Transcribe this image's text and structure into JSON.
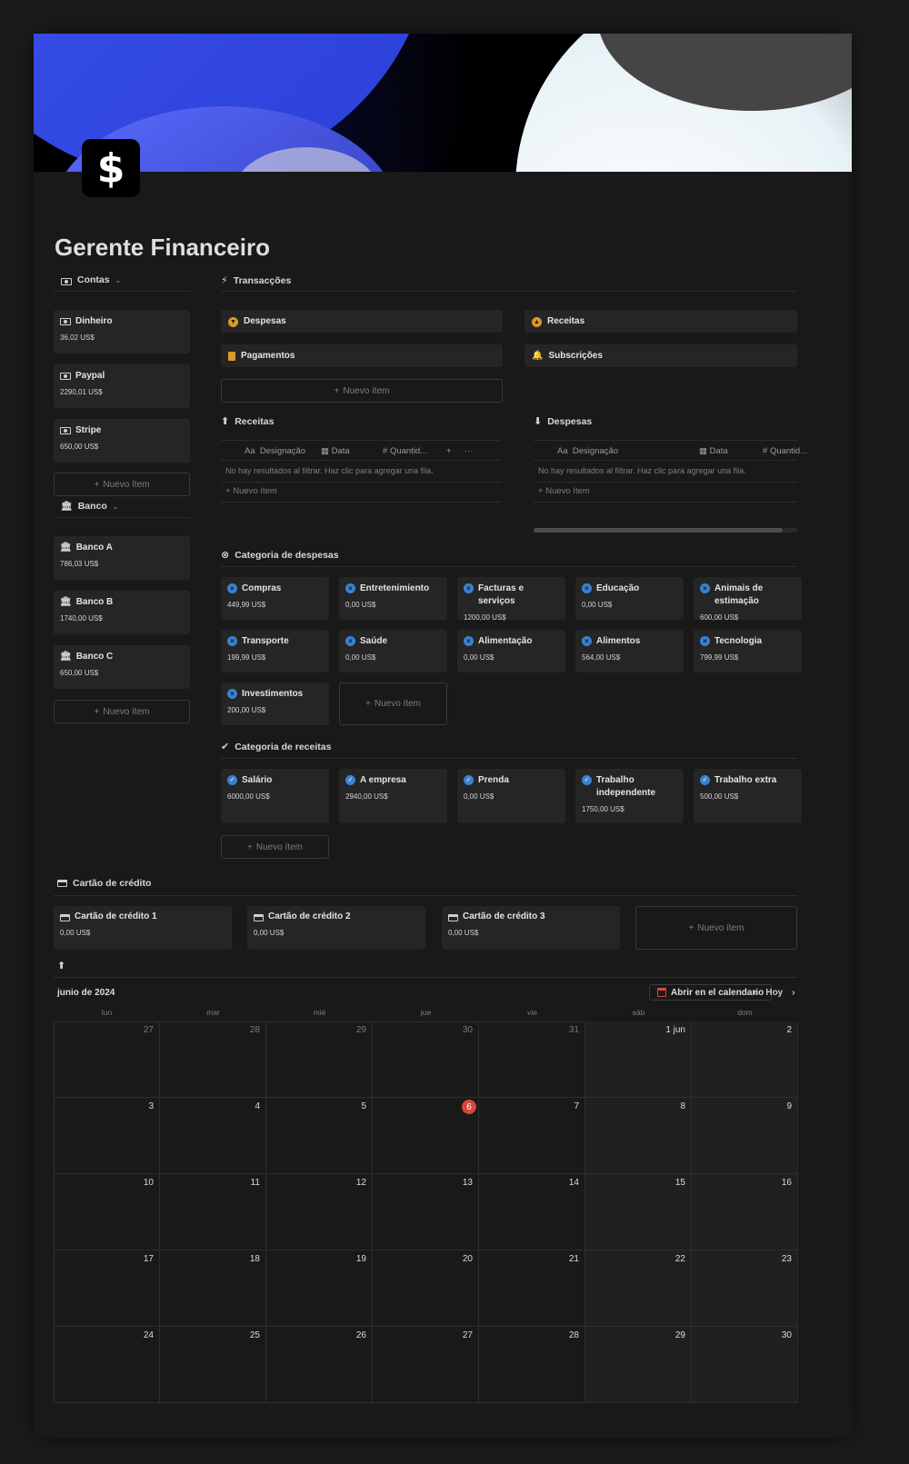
{
  "page": {
    "title": "Gerente Financeiro",
    "icon": "dollar-icon",
    "icon_glyph": "$"
  },
  "colors": {
    "background": "#191919",
    "card": "#252525",
    "accent_blue": "#3a82d0",
    "accent_orange": "#d99a2b",
    "today_red": "#d9453c"
  },
  "contas": {
    "heading": "Contas",
    "items": [
      {
        "name": "Dinheiro",
        "value": "36,02 US$"
      },
      {
        "name": "Paypal",
        "value": "2290,01 US$"
      },
      {
        "name": "Stripe",
        "value": "650,00 US$"
      }
    ],
    "new_label": "Nuevo ítem"
  },
  "banco": {
    "heading": "Banco",
    "items": [
      {
        "name": "Banco A",
        "value": "786,03 US$"
      },
      {
        "name": "Banco B",
        "value": "1740,00 US$"
      },
      {
        "name": "Banco C",
        "value": "650,00 US$"
      }
    ],
    "new_label": "Nuevo ítem"
  },
  "transaccoes": {
    "heading": "Transacções",
    "items": [
      "Despesas",
      "Receitas",
      "Pagamentos",
      "Subscrições"
    ],
    "new_label": "Nuevo ítem"
  },
  "receitas_table": {
    "heading": "Receitas",
    "cols": [
      "Designação",
      "Data",
      "Quantid..."
    ],
    "col_prefix": "Aa",
    "add_col": "+",
    "more": "···",
    "empty": "No hay resultados al filtrar. Haz clic para agregar una fila.",
    "new_label": "Nuevo ítem"
  },
  "despesas_table": {
    "heading": "Despesas",
    "cols": [
      "Designação",
      "Data",
      "Quantid..."
    ],
    "col_prefix": "Aa",
    "empty": "No hay resultados al filtrar. Haz clic para agregar una fila.",
    "new_label": "Nuevo ítem"
  },
  "categoria_despesas": {
    "heading": "Categoria de despesas",
    "items": [
      {
        "name": "Compras",
        "value": "449,99 US$"
      },
      {
        "name": "Entretenimiento",
        "value": "0,00 US$"
      },
      {
        "name": "Facturas e serviços",
        "value": "1200,00 US$"
      },
      {
        "name": "Educação",
        "value": "0,00 US$"
      },
      {
        "name": "Animais de estimação",
        "value": "600,00 US$"
      },
      {
        "name": "Transporte",
        "value": "199,99 US$"
      },
      {
        "name": "Saúde",
        "value": "0,00 US$"
      },
      {
        "name": "Alimentação",
        "value": "0,00 US$"
      },
      {
        "name": "Alimentos",
        "value": "564,00 US$"
      },
      {
        "name": "Tecnologia",
        "value": "799,99 US$"
      },
      {
        "name": "Investimentos",
        "value": "200,00 US$"
      }
    ],
    "new_label": "Nuevo ítem"
  },
  "categoria_receitas": {
    "heading": "Categoria de receitas",
    "items": [
      {
        "name": "Salário",
        "value": "6000,00 US$"
      },
      {
        "name": "A empresa",
        "value": "2940,00 US$"
      },
      {
        "name": "Prenda",
        "value": "0,00 US$"
      },
      {
        "name": "Trabalho independente",
        "value": "1750,00 US$"
      },
      {
        "name": "Trabalho extra",
        "value": "500,00 US$"
      }
    ],
    "new_label": "Nuevo ítem"
  },
  "cartao": {
    "heading": "Cartão de crédito",
    "items": [
      {
        "name": "Cartão de crédito 1",
        "value": "0,00 US$"
      },
      {
        "name": "Cartão de crédito 2",
        "value": "0,00 US$"
      },
      {
        "name": "Cartão de crédito 3",
        "value": "0,00 US$"
      }
    ],
    "new_label": "Nuevo ítem"
  },
  "calendar": {
    "month": "junio de 2024",
    "open_label": "Abrir en el calendario",
    "today_label": "Hoy",
    "weekdays": [
      "lun",
      "mar",
      "mié",
      "jue",
      "vie",
      "sáb",
      "dom"
    ],
    "weeks": [
      [
        "27",
        "28",
        "29",
        "30",
        "31",
        "1 jun",
        "2"
      ],
      [
        "3",
        "4",
        "5",
        "6",
        "7",
        "8",
        "9"
      ],
      [
        "10",
        "11",
        "12",
        "13",
        "14",
        "15",
        "16"
      ],
      [
        "17",
        "18",
        "19",
        "20",
        "21",
        "22",
        "23"
      ],
      [
        "24",
        "25",
        "26",
        "27",
        "28",
        "29",
        "30"
      ]
    ],
    "today": "6"
  }
}
